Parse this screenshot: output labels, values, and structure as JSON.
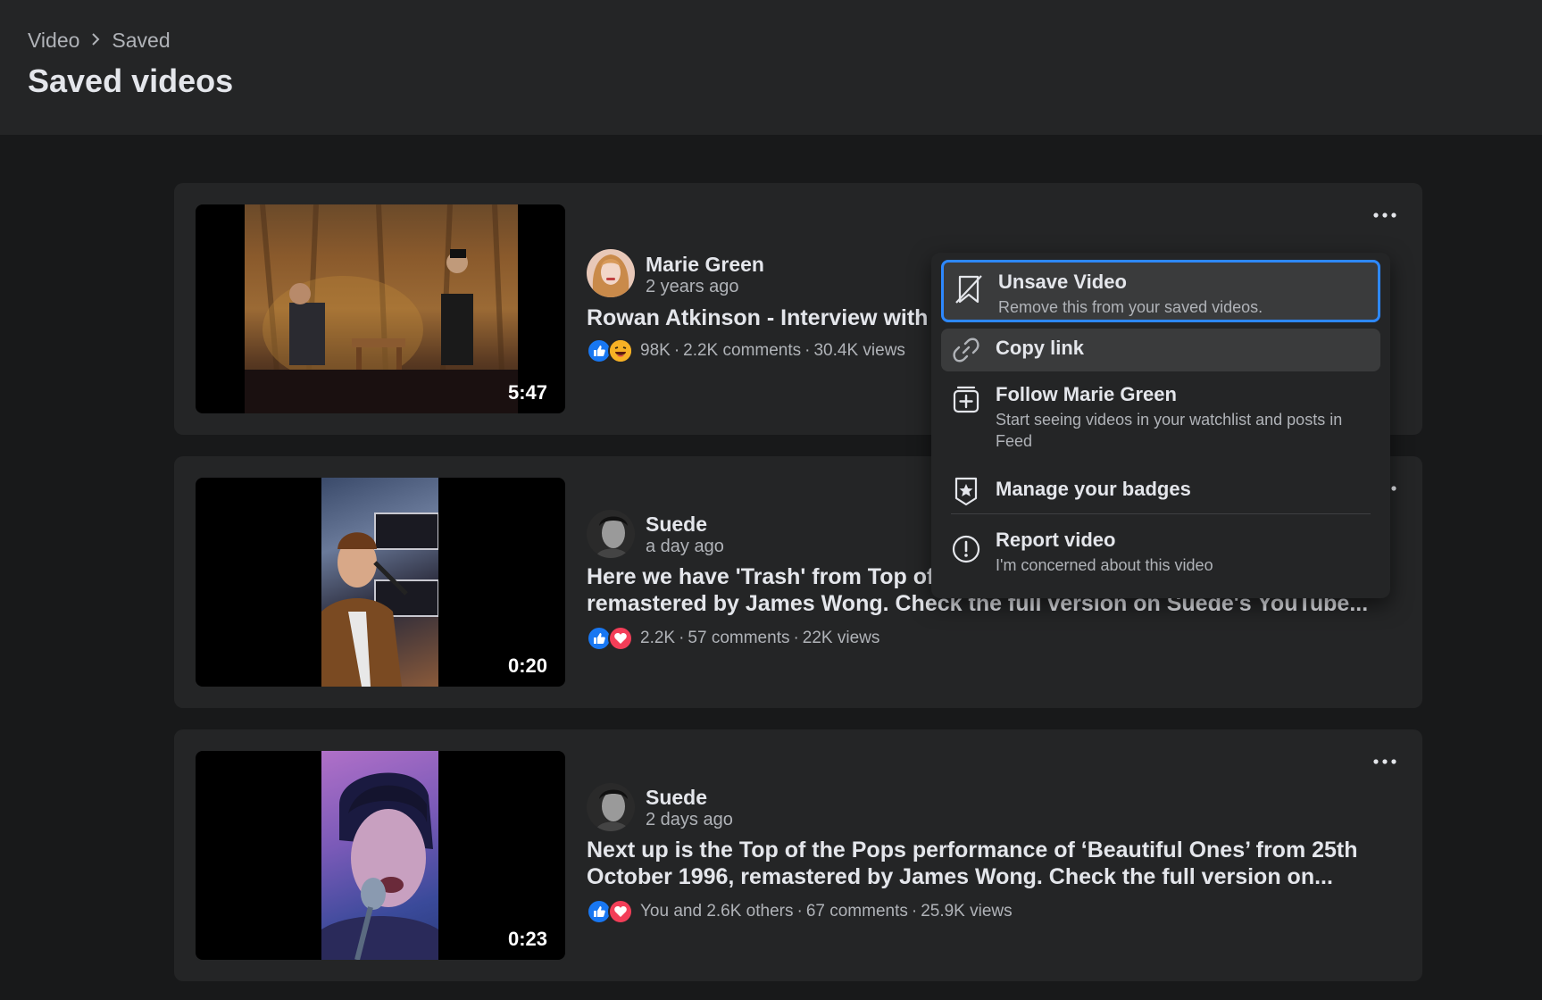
{
  "breadcrumb": {
    "items": [
      "Video",
      "Saved"
    ]
  },
  "page": {
    "title": "Saved videos"
  },
  "videos": [
    {
      "duration": "5:47",
      "author": "Marie Green",
      "time": "2 years ago",
      "title_line1": "Rowan Atkinson - Interview with",
      "title_line2": "",
      "reactions": [
        "like",
        "haha"
      ],
      "stats": [
        "98K",
        "2.2K comments",
        "30.4K views"
      ]
    },
    {
      "duration": "0:20",
      "author": "Suede",
      "time": "a day ago",
      "title_line1": "Here we have 'Trash' from Top of",
      "title_line2": "remastered by James Wong. Check the full version on Suede's YouTube...",
      "reactions": [
        "like",
        "love"
      ],
      "stats": [
        "2.2K",
        "57 comments",
        "22K views"
      ]
    },
    {
      "duration": "0:23",
      "author": "Suede",
      "time": "2 days ago",
      "title_line1": "Next up is the Top of the Pops performance of ‘Beautiful Ones’ from 25th",
      "title_line2": "October 1996, remastered by James Wong. Check the full version on...",
      "reactions": [
        "like",
        "love"
      ],
      "stats": [
        "You and 2.6K others",
        "67 comments",
        "25.9K views"
      ]
    }
  ],
  "menu": {
    "unsave": {
      "label": "Unsave Video",
      "desc": "Remove this from your saved videos.",
      "icon": "unsave-bookmark-icon"
    },
    "copy": {
      "label": "Copy link",
      "icon": "link-icon"
    },
    "follow": {
      "label": "Follow Marie Green",
      "desc": "Start seeing videos in your watchlist and posts in Feed",
      "icon": "follow-plus-icon"
    },
    "badges": {
      "label": "Manage your badges",
      "icon": "badge-icon"
    },
    "report": {
      "label": "Report video",
      "desc": "I'm concerned about this video",
      "icon": "report-icon"
    }
  },
  "colors": {
    "background": "#18191a",
    "card": "#242526",
    "menu_hover": "#3a3b3c",
    "focus_ring": "#2d88ff",
    "like": "#1877f2",
    "love": "#f33e58",
    "haha": "#f7b125"
  }
}
